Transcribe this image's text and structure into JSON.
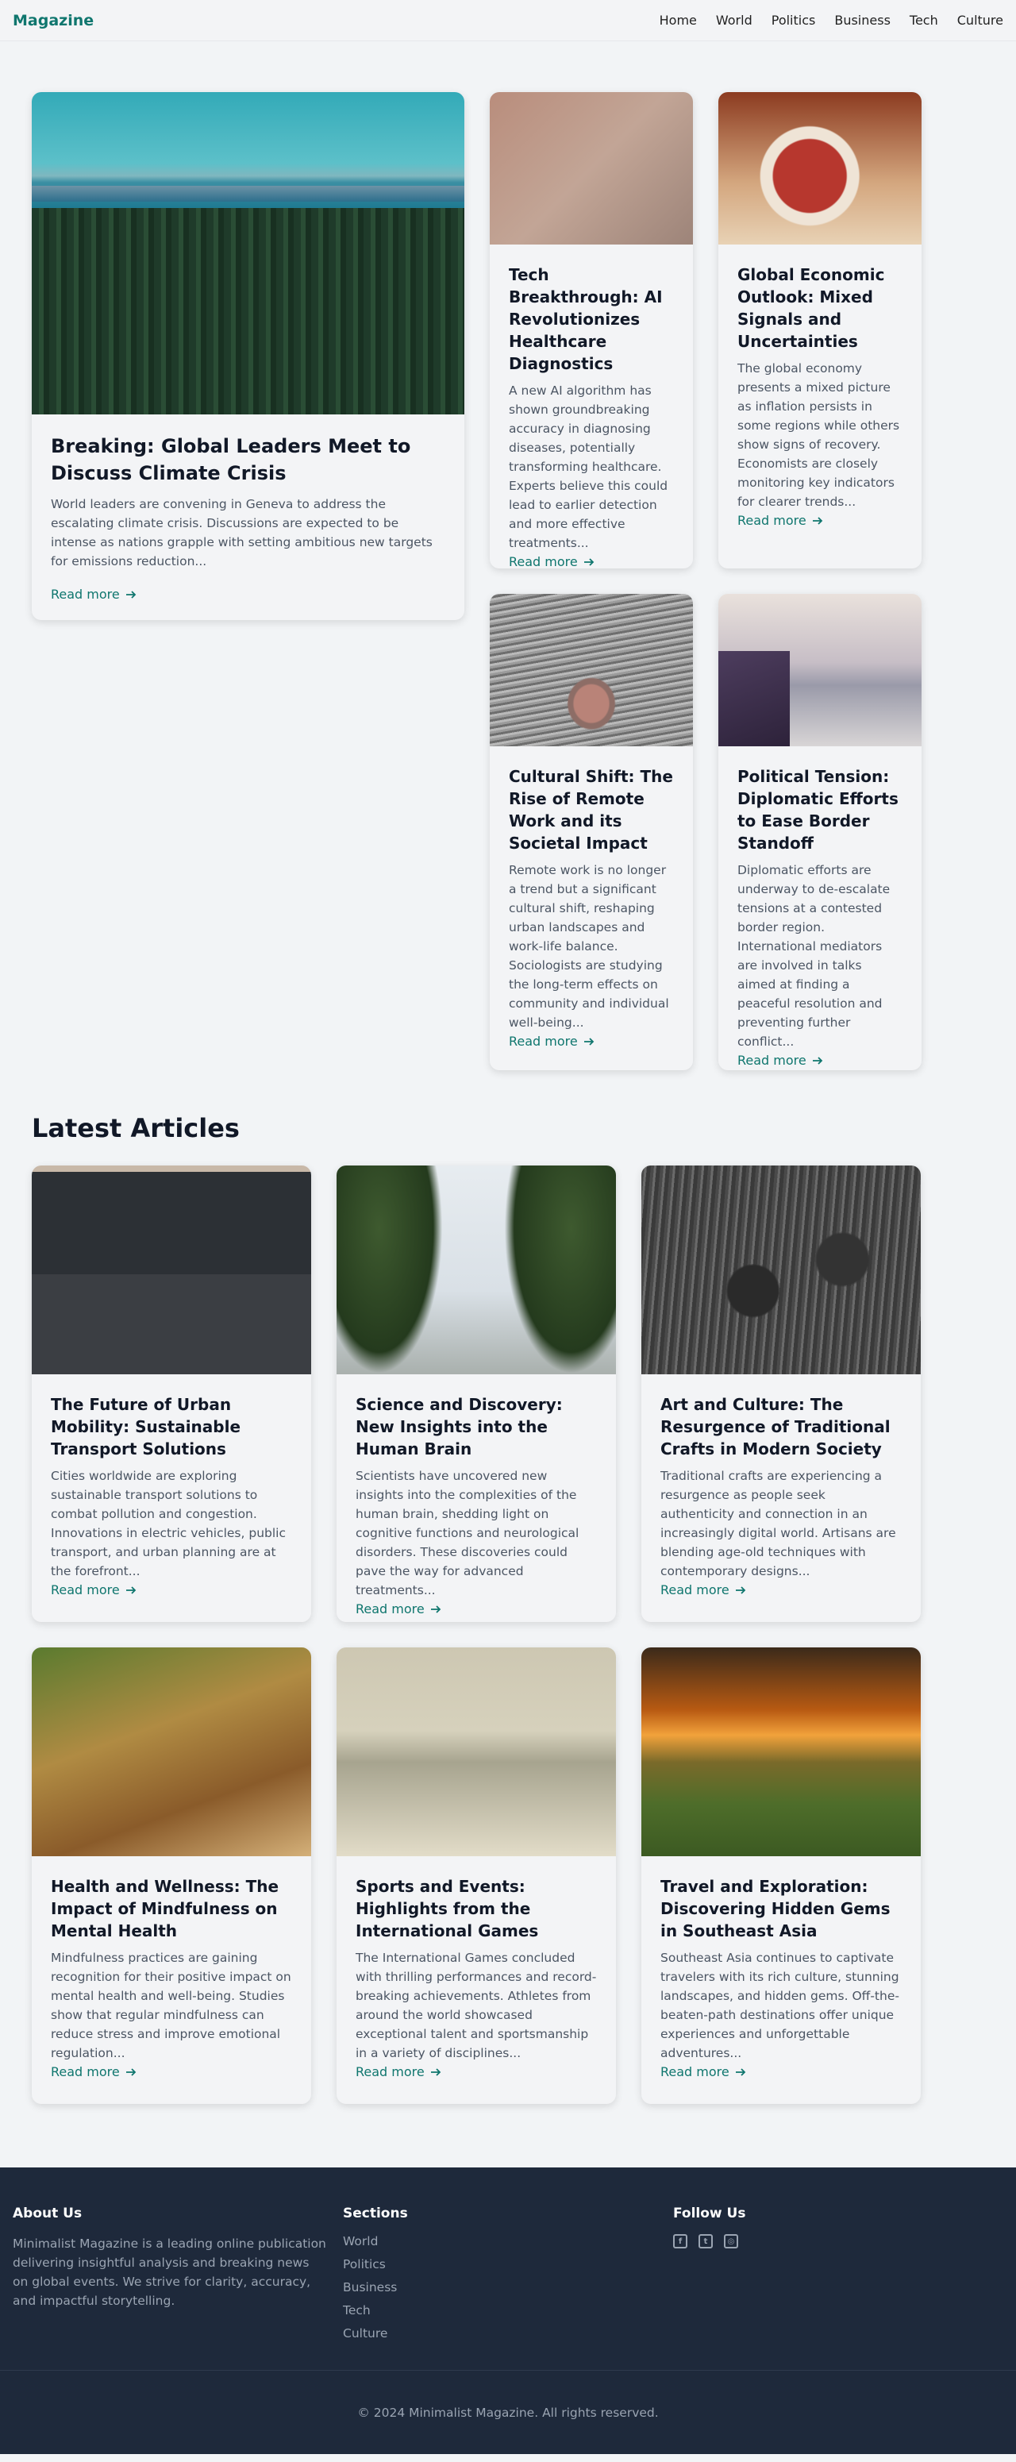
{
  "header": {
    "brand": "Magazine",
    "nav": [
      "Home",
      "World",
      "Politics",
      "Business",
      "Tech",
      "Culture"
    ]
  },
  "featured": {
    "main": {
      "title": "Breaking: Global Leaders Meet to Discuss Climate Crisis",
      "excerpt": "World leaders are convening in Geneva to address the escalating climate crisis. Discussions are expected to be intense as nations grapple with setting ambitious new targets for emissions reduction...",
      "link": "Read more"
    },
    "side": [
      {
        "title": "Tech Breakthrough: AI Revolutionizes Healthcare Diagnostics",
        "excerpt": "A new AI algorithm has shown groundbreaking accuracy in diagnosing diseases, potentially transforming healthcare. Experts believe this could lead to earlier detection and more effective treatments...",
        "link": "Read more"
      },
      {
        "title": "Global Economic Outlook: Mixed Signals and Uncertainties",
        "excerpt": "The global economy presents a mixed picture as inflation persists in some regions while others show signs of recovery. Economists are closely monitoring key indicators for clearer trends...",
        "link": "Read more"
      },
      {
        "title": "Cultural Shift: The Rise of Remote Work and its Societal Impact",
        "excerpt": "Remote work is no longer a trend but a significant cultural shift, reshaping urban landscapes and work-life balance. Sociologists are studying the long-term effects on community and individual well-being...",
        "link": "Read more"
      },
      {
        "title": "Political Tension: Diplomatic Efforts to Ease Border Standoff",
        "excerpt": "Diplomatic efforts are underway to de-escalate tensions at a contested border region. International mediators are involved in talks aimed at finding a peaceful resolution and preventing further conflict...",
        "link": "Read more"
      }
    ]
  },
  "latest": {
    "heading": "Latest Articles",
    "articles": [
      {
        "title": "The Future of Urban Mobility: Sustainable Transport Solutions",
        "excerpt": "Cities worldwide are exploring sustainable transport solutions to combat pollution and congestion. Innovations in electric vehicles, public transport, and urban planning are at the forefront...",
        "link": "Read more"
      },
      {
        "title": "Science and Discovery: New Insights into the Human Brain",
        "excerpt": "Scientists have uncovered new insights into the complexities of the human brain, shedding light on cognitive functions and neurological disorders. These discoveries could pave the way for advanced treatments...",
        "link": "Read more"
      },
      {
        "title": "Art and Culture: The Resurgence of Traditional Crafts in Modern Society",
        "excerpt": "Traditional crafts are experiencing a resurgence as people seek authenticity and connection in an increasingly digital world. Artisans are blending age-old techniques with contemporary designs...",
        "link": "Read more"
      },
      {
        "title": "Health and Wellness: The Impact of Mindfulness on Mental Health",
        "excerpt": "Mindfulness practices are gaining recognition for their positive impact on mental health and well-being. Studies show that regular mindfulness can reduce stress and improve emotional regulation...",
        "link": "Read more"
      },
      {
        "title": "Sports and Events: Highlights from the International Games",
        "excerpt": "The International Games concluded with thrilling performances and record-breaking achievements. Athletes from around the world showcased exceptional talent and sportsmanship in a variety of disciplines...",
        "link": "Read more"
      },
      {
        "title": "Travel and Exploration: Discovering Hidden Gems in Southeast Asia",
        "excerpt": "Southeast Asia continues to captivate travelers with its rich culture, stunning landscapes, and hidden gems. Off-the-beaten-path destinations offer unique experiences and unforgettable adventures...",
        "link": "Read more"
      }
    ]
  },
  "footer": {
    "about": {
      "heading": "About Us",
      "text": "Minimalist Magazine is a leading online publication delivering insightful analysis and breaking news on global events. We strive for clarity, accuracy, and impactful storytelling."
    },
    "sections": {
      "heading": "Sections",
      "items": [
        "World",
        "Politics",
        "Business",
        "Tech",
        "Culture"
      ]
    },
    "follow": {
      "heading": "Follow Us",
      "icons": [
        "facebook-icon",
        "twitter-icon",
        "instagram-icon"
      ]
    },
    "copyright": "© 2024 Minimalist Magazine. All rights reserved."
  },
  "colors": {
    "accent": "#0f766e",
    "footer_bg": "#1e293b",
    "page_bg": "#f2f4f6"
  }
}
